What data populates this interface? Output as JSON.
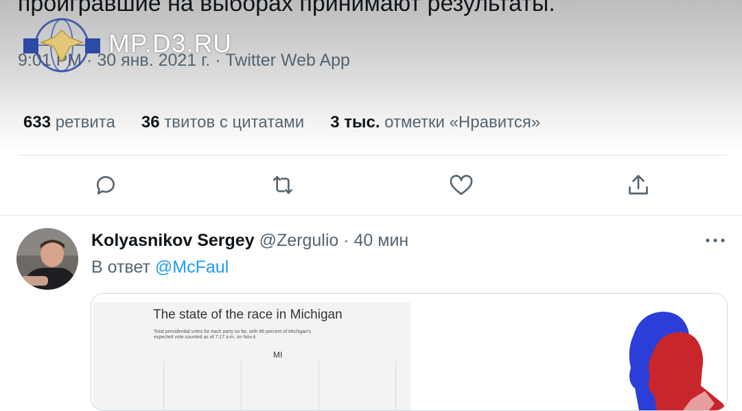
{
  "tweet": {
    "text_tail": "проигравшие на выборах принимают результаты.",
    "meta_time": "9:01 PM",
    "meta_rest": " · 30 янв. 2021 г. · Twitter Web App"
  },
  "watermark": {
    "text": "MP.D3.RU"
  },
  "stats": [
    {
      "count": "633",
      "label": "ретвита"
    },
    {
      "count": "36",
      "label": "твитов с цитатами"
    },
    {
      "count": "3 тыс.",
      "label": "отметки «Нравится»"
    }
  ],
  "actions": [
    {
      "name": "reply",
      "icon": "speech-bubble-icon"
    },
    {
      "name": "retweet",
      "icon": "retweet-arrows-icon"
    },
    {
      "name": "like",
      "icon": "heart-icon"
    },
    {
      "name": "share",
      "icon": "share-upload-icon"
    }
  ],
  "reply_tweet": {
    "author_name": "Kolyasnikov Sergey",
    "handle": "@Zergulio",
    "separator": "·",
    "time": "40 мин",
    "reply_prefix": "В ответ",
    "reply_to": "@McFaul",
    "more_icon": "more-dots-icon"
  },
  "media": {
    "chart_title": "The state of the race in Michigan",
    "chart_subtitle": "Total presidential votes for each party so far, with 86 percent of Michigan's expected vote counted as of 7:17 a.m. on Nov.4",
    "chart_label": "MI"
  },
  "colors": {
    "accent": "#1d9bf0",
    "secondary_text": "#536471",
    "icon": "#536471",
    "silhouette_blue": "#2b3fd8",
    "silhouette_red": "#c8262b"
  }
}
